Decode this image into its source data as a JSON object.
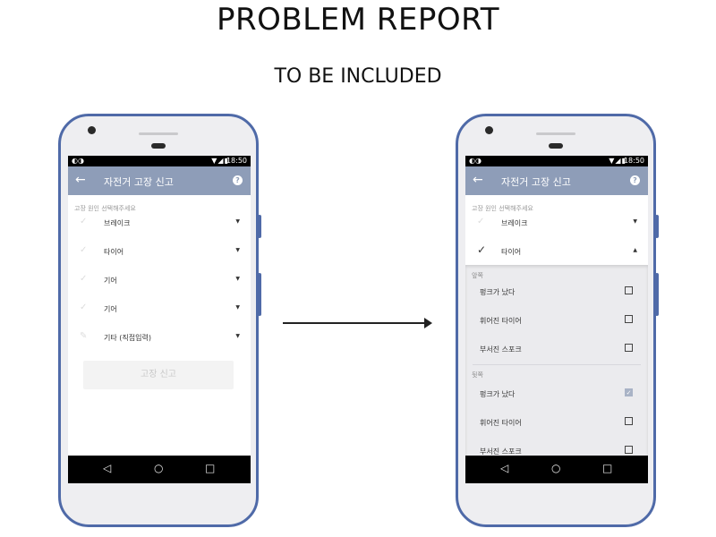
{
  "page": {
    "title": "PROBLEM REPORT",
    "subtitle": "TO BE INCLUDED"
  },
  "status_bar": {
    "time": "18:50",
    "left_icon": "notification-icon",
    "icons": "▼◢▮"
  },
  "app_bar": {
    "back_icon": "←",
    "title": "자전거 고장 신고",
    "help_icon": "?"
  },
  "form": {
    "section_label": "고장 원인 선택해주세요",
    "check_mark": "✓",
    "caret_down": "▼",
    "caret_up": "▲",
    "items": [
      {
        "label": "브레이크"
      },
      {
        "label": "타이어"
      },
      {
        "label": "기어"
      },
      {
        "label": "기어"
      },
      {
        "label": "기타 (직접입력)"
      }
    ],
    "submit_label": "고장 신고",
    "submit_enabled": false
  },
  "tire_panel": {
    "expanded_item": "타이어",
    "groups": [
      {
        "label": "앞쪽",
        "options": [
          {
            "label": "펑크가 났다",
            "checked": false
          },
          {
            "label": "휘어진 타이어",
            "checked": false
          },
          {
            "label": "부서진 스포크",
            "checked": false
          }
        ]
      },
      {
        "label": "뒷쪽",
        "options": [
          {
            "label": "펑크가 났다",
            "checked": true
          },
          {
            "label": "휘어진 타이어",
            "checked": false
          },
          {
            "label": "부서진 스포크",
            "checked": false
          }
        ]
      }
    ],
    "checked_mark": "✓"
  },
  "nav_bar": {
    "back": "◁",
    "home": "○",
    "recents": "□"
  },
  "colors": {
    "phone_frame": "#4f6aa8",
    "app_bar": "#8e9db8",
    "checked_box": "#a9b3c6"
  }
}
